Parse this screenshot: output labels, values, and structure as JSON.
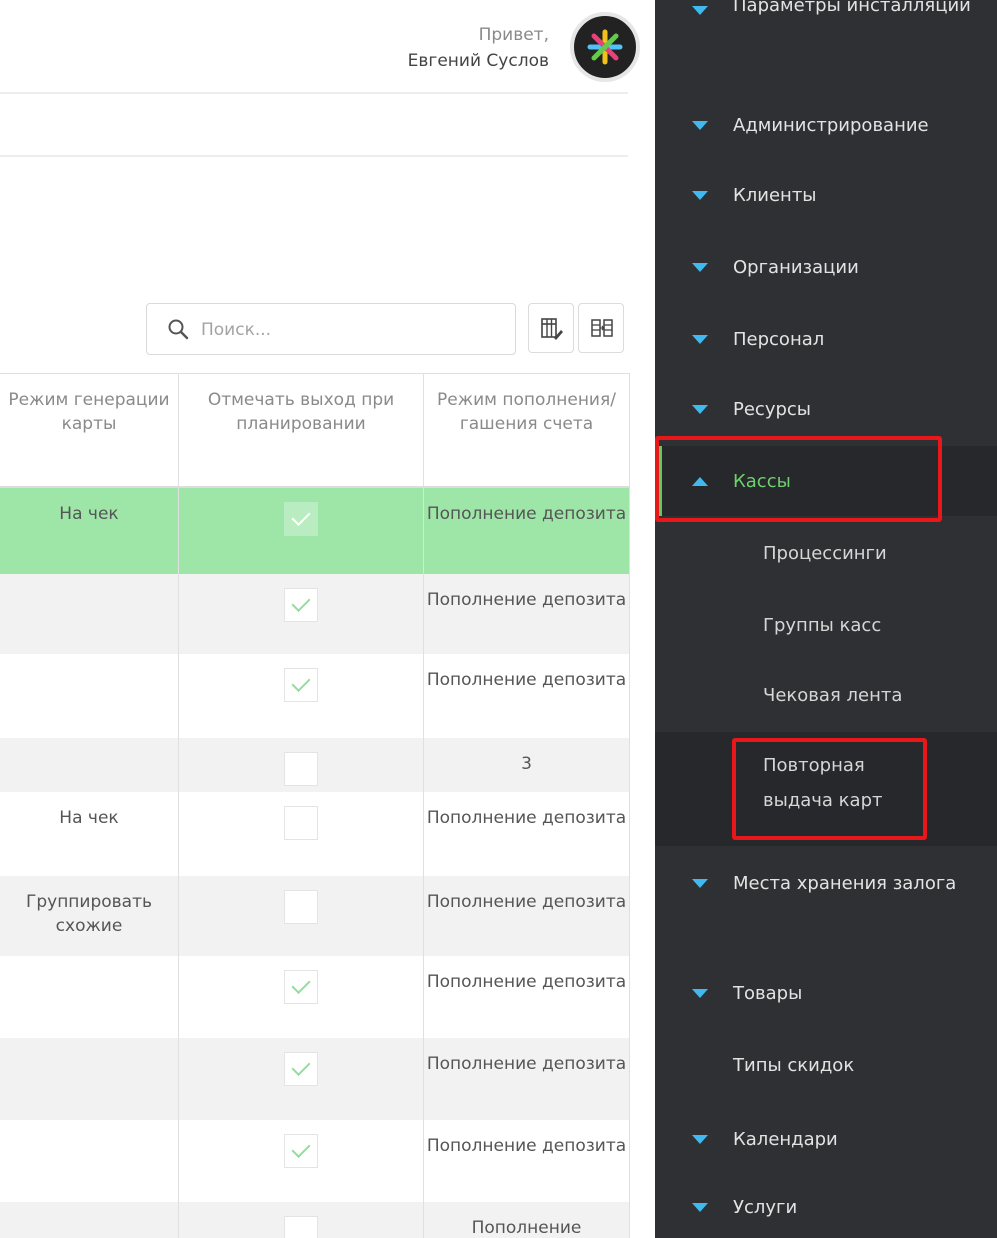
{
  "header": {
    "greeting": "Привет,",
    "user_name": "Евгений Суслов"
  },
  "toolbar": {
    "search_placeholder": "Поиск...",
    "columns_icon": "columns-edit-icon",
    "export_icon": "grid-export-icon"
  },
  "table": {
    "columns": [
      "Режим генерации карты",
      "Отмечать выход при планировании",
      "Режим пополнения/ гашения счета"
    ],
    "rows": [
      {
        "card_mode": "На чек",
        "checked": true,
        "account_mode": "Пополнение депозита"
      },
      {
        "card_mode": "",
        "checked": true,
        "account_mode": "Пополнение депозита"
      },
      {
        "card_mode": "",
        "checked": true,
        "account_mode": "Пополнение депозита"
      },
      {
        "card_mode": "",
        "checked": false,
        "account_mode": "3"
      },
      {
        "card_mode": "На чек",
        "checked": false,
        "account_mode": "Пополнение депозита"
      },
      {
        "card_mode": "Группировать схожие",
        "checked": false,
        "account_mode": "Пополнение депозита"
      },
      {
        "card_mode": "",
        "checked": true,
        "account_mode": "Пополнение депозита"
      },
      {
        "card_mode": "",
        "checked": true,
        "account_mode": "Пополнение депозита"
      },
      {
        "card_mode": "",
        "checked": true,
        "account_mode": "Пополнение депозита"
      },
      {
        "card_mode": "",
        "checked": false,
        "account_mode": "Пополнение"
      }
    ]
  },
  "sidebar": {
    "items": [
      {
        "label": "Параметры инсталляции",
        "expanded": false
      },
      {
        "label": "Администрирование",
        "expanded": false
      },
      {
        "label": "Клиенты",
        "expanded": false
      },
      {
        "label": "Организации",
        "expanded": false
      },
      {
        "label": "Персонал",
        "expanded": false
      },
      {
        "label": "Ресурсы",
        "expanded": false
      },
      {
        "label": "Кассы",
        "expanded": true,
        "active": true
      },
      {
        "label": "Места хранения залога",
        "expanded": false
      },
      {
        "label": "Товары",
        "expanded": false
      },
      {
        "label": "Типы скидок",
        "expanded": false,
        "no_icon": true
      },
      {
        "label": "Календари",
        "expanded": false
      },
      {
        "label": "Услуги",
        "expanded": false
      }
    ],
    "kassy_children": [
      "Процессинги",
      "Группы касс",
      "Чековая лента",
      "Повторная выдача карт"
    ]
  },
  "colors": {
    "sidebar_bg": "#2e3033",
    "arrow": "#3fb9ee",
    "active_text": "#6fd06f",
    "selected_row": "#9ee6a8",
    "highlight": "#e8181a"
  }
}
